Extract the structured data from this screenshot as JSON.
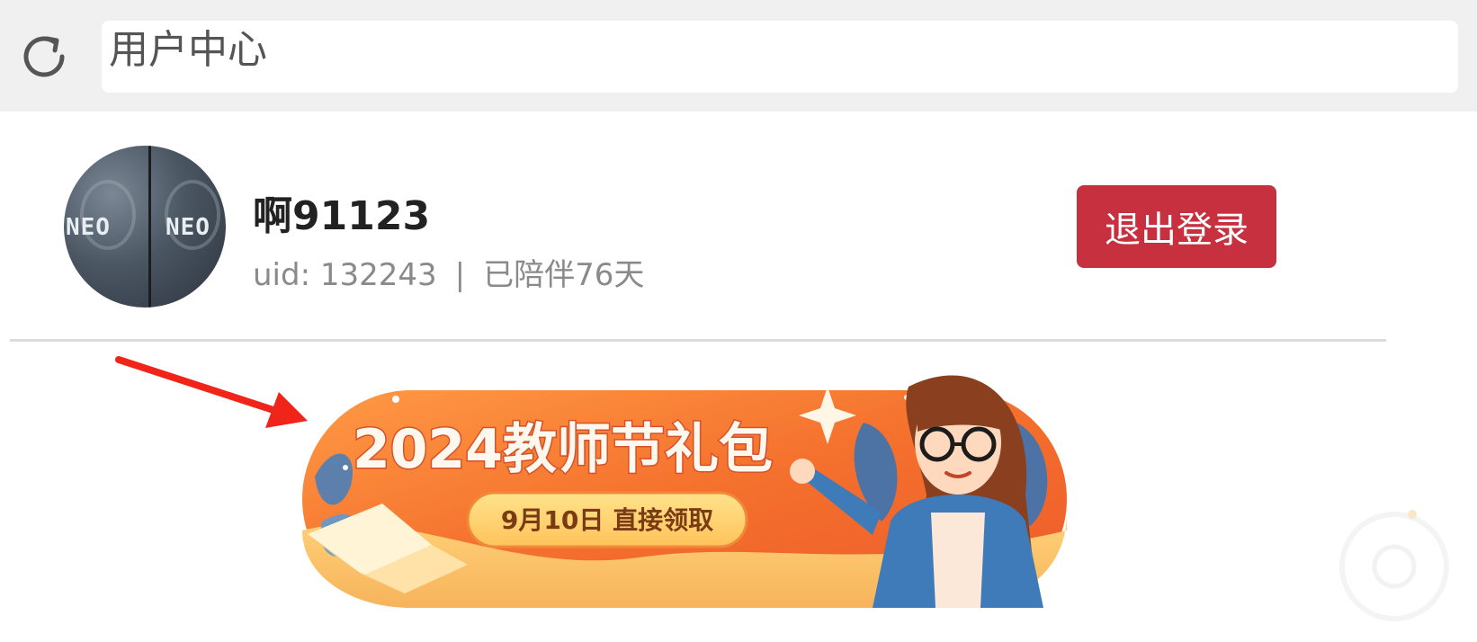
{
  "toolbar": {
    "refresh_icon": "refresh-icon",
    "address_value": "用户中心"
  },
  "profile": {
    "avatar_text_left": "NEO",
    "avatar_text_right": "NEO",
    "username": "啊91123",
    "uid_label": "uid: 132243",
    "separator": "|",
    "days": "已陪伴76天",
    "logout_label": "退出登录"
  },
  "banner": {
    "title": "2024教师节礼包",
    "subtitle": "9月10日  直接领取"
  },
  "colors": {
    "logout_bg": "#c6303f",
    "banner_orange": "#f26a2a",
    "arrow_red": "#f02418"
  }
}
